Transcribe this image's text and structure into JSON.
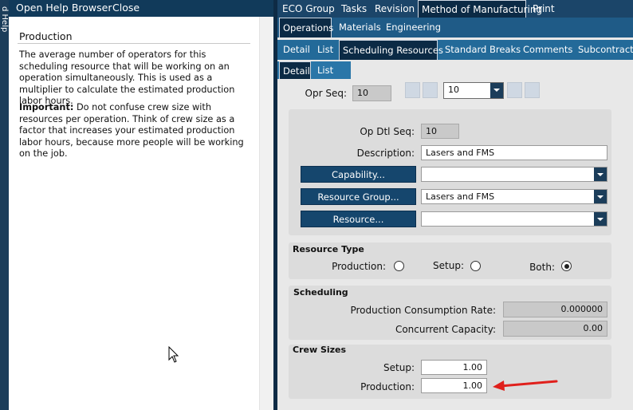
{
  "help": {
    "side_label": "d Help",
    "toolbar": {
      "open_browser": "Open Help Browser",
      "close": "Close"
    },
    "title": "Production",
    "paragraph1": "The average number of operators for this scheduling resource that will be working on an operation simultaneously. This is used as a multiplier to calculate the estimated production labor hours.",
    "important_label": "Important:",
    "paragraph2": "Do not confuse crew size with resources per operation. Think of crew size as a factor that increases your estimated production labor hours, because more people will be working on the job."
  },
  "tabs": {
    "row1": [
      "ECO Group",
      "Tasks",
      "Revision",
      "Method of Manufacturing",
      "Print"
    ],
    "row1_selected": "Method of Manufacturing",
    "row2": [
      "Operations",
      "Materials",
      "Engineering"
    ],
    "row2_selected": "Operations",
    "row3": [
      "Detail",
      "List",
      "Scheduling Resources",
      "Standard Breaks",
      "Comments",
      "Subcontract"
    ],
    "row3_selected": "Scheduling Resources",
    "row4": [
      "Detail",
      "List"
    ],
    "row4_selected": "Detail"
  },
  "form": {
    "opr_seq_label": "Opr Seq:",
    "opr_seq_value": "10",
    "opr_seq_combo": "10",
    "op_dtl_seq_label": "Op Dtl Seq:",
    "op_dtl_seq_value": "10",
    "description_label": "Description:",
    "description_value": "Lasers and FMS",
    "capability_button": "Capability...",
    "capability_value": "",
    "resource_group_button": "Resource Group...",
    "resource_group_value": "Lasers and FMS",
    "resource_button": "Resource...",
    "resource_value": ""
  },
  "resource_type": {
    "title": "Resource Type",
    "production_label": "Production:",
    "setup_label": "Setup:",
    "both_label": "Both:",
    "selected": "Both"
  },
  "scheduling": {
    "title": "Scheduling",
    "consumption_rate_label": "Production Consumption Rate:",
    "consumption_rate_value": "0.000000",
    "concurrent_capacity_label": "Concurrent Capacity:",
    "concurrent_capacity_value": "0.00"
  },
  "crew_sizes": {
    "title": "Crew Sizes",
    "setup_label": "Setup:",
    "setup_value": "1.00",
    "production_label": "Production:",
    "production_value": "1.00"
  },
  "colors": {
    "annotation_arrow": "#e0201c",
    "nav_dark": "#113a5a",
    "button": "#15466d"
  }
}
